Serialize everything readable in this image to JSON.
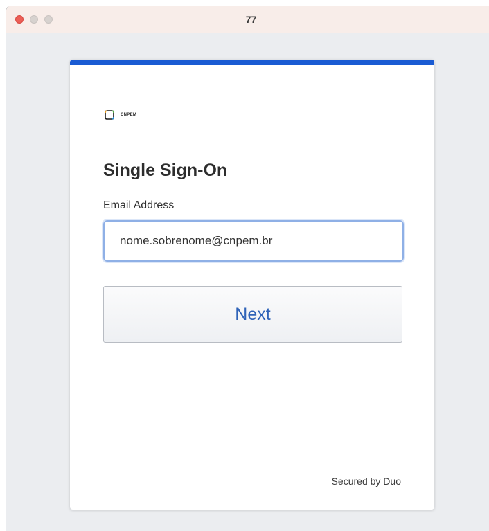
{
  "window": {
    "title": "77"
  },
  "colors": {
    "accent": "#1a5bd3",
    "button_text": "#2f63b8",
    "input_border": "#8fb0e6",
    "window_close": "#ec5f57"
  },
  "logo": {
    "icon": "cnpem-logo-icon",
    "text": "CNPEM"
  },
  "form": {
    "heading": "Single Sign-On",
    "email_label": "Email Address",
    "email_value": "nome.sobrenome@cnpem.br",
    "next_label": "Next"
  },
  "footer": {
    "text": "Secured by Duo"
  }
}
